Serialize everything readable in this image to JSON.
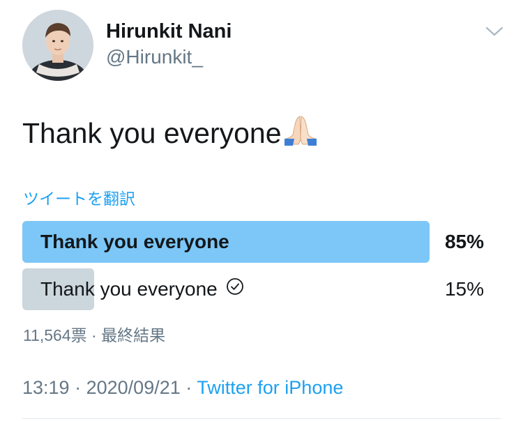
{
  "user": {
    "name": "Hirunkit Nani",
    "handle": "@Hirunkit_"
  },
  "tweet": {
    "text": "Thank you everyone",
    "emoji": "🙏",
    "translate_label": "ツイートを翻訳"
  },
  "poll": {
    "options": [
      {
        "label": "Thank you everyone",
        "percent_text": "85%",
        "percent": 85,
        "winner": true
      },
      {
        "label": "Thank you everyone",
        "percent_text": "15%",
        "percent": 15,
        "winner": false,
        "voted": true
      }
    ],
    "votes": "11,564票",
    "separator": "·",
    "status": "最終結果"
  },
  "footer": {
    "time": "13:19",
    "date": "2020/09/21",
    "separator": "·",
    "source": "Twitter for iPhone"
  },
  "colors": {
    "accent": "#1da1f2",
    "winner_bar": "#7cc7f7",
    "other_bar": "#ccd6dd",
    "secondary_text": "#657786"
  },
  "icons": {
    "menu": "chevron-down-icon",
    "voted": "check-circle-icon",
    "emoji": "folded-hands-icon"
  }
}
